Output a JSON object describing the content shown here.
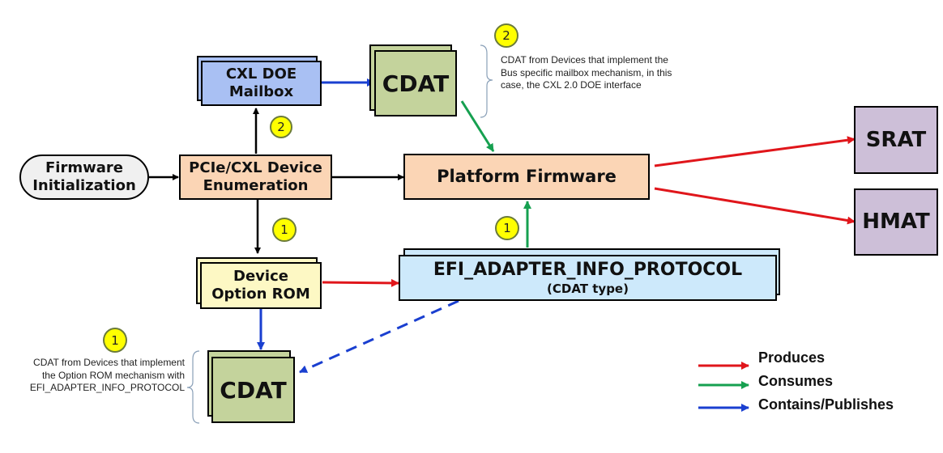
{
  "nodes": {
    "firmware_init": {
      "line1": "Firmware",
      "line2": "Initialization"
    },
    "enumeration": {
      "line1": "PCIe/CXL Device",
      "line2": "Enumeration"
    },
    "doe_mailbox": {
      "line1": "CXL DOE",
      "line2": "Mailbox"
    },
    "cdat_top": {
      "label": "CDAT"
    },
    "platform_firmware": {
      "label": "Platform Firmware"
    },
    "srat": {
      "label": "SRAT"
    },
    "hmat": {
      "label": "HMAT"
    },
    "option_rom": {
      "line1": "Device",
      "line2": "Option ROM"
    },
    "efi_protocol": {
      "line1": "EFI_ADAPTER_INFO_PROTOCOL",
      "line2": "(CDAT type)"
    },
    "cdat_bottom": {
      "label": "CDAT"
    }
  },
  "badges": {
    "b_doe": "2",
    "b_note_top": "2",
    "b_enum_down": "1",
    "b_efi_up": "1",
    "b_note_bottom": "1"
  },
  "notes": {
    "top": {
      "line1": "CDAT from Devices that implement the",
      "line2": "Bus specific mailbox mechanism, in this",
      "line3": "case, the CXL 2.0 DOE interface"
    },
    "bottom": {
      "line1": "CDAT from Devices that implement",
      "line2": "the Option ROM mechanism with",
      "line3": "EFI_ADAPTER_INFO_PROTOCOL"
    }
  },
  "legend": [
    {
      "label": "Produces",
      "color": "#e0161b"
    },
    {
      "label": "Consumes",
      "color": "#16a050"
    },
    {
      "label": "Contains/Publishes",
      "color": "#1a3fd0"
    }
  ],
  "colors": {
    "produces": "#e0161b",
    "consumes": "#16a050",
    "contains": "#1a3fd0",
    "control": "#000000",
    "peach": "#fbd5b5",
    "blue_box": "#a9c0f3",
    "green_box": "#c4d39c",
    "purple_box": "#cdbfd8",
    "yellow_box": "#fdf8c4",
    "light_blue_box": "#cde9fb",
    "gray_pill": "#f0f0f0"
  }
}
